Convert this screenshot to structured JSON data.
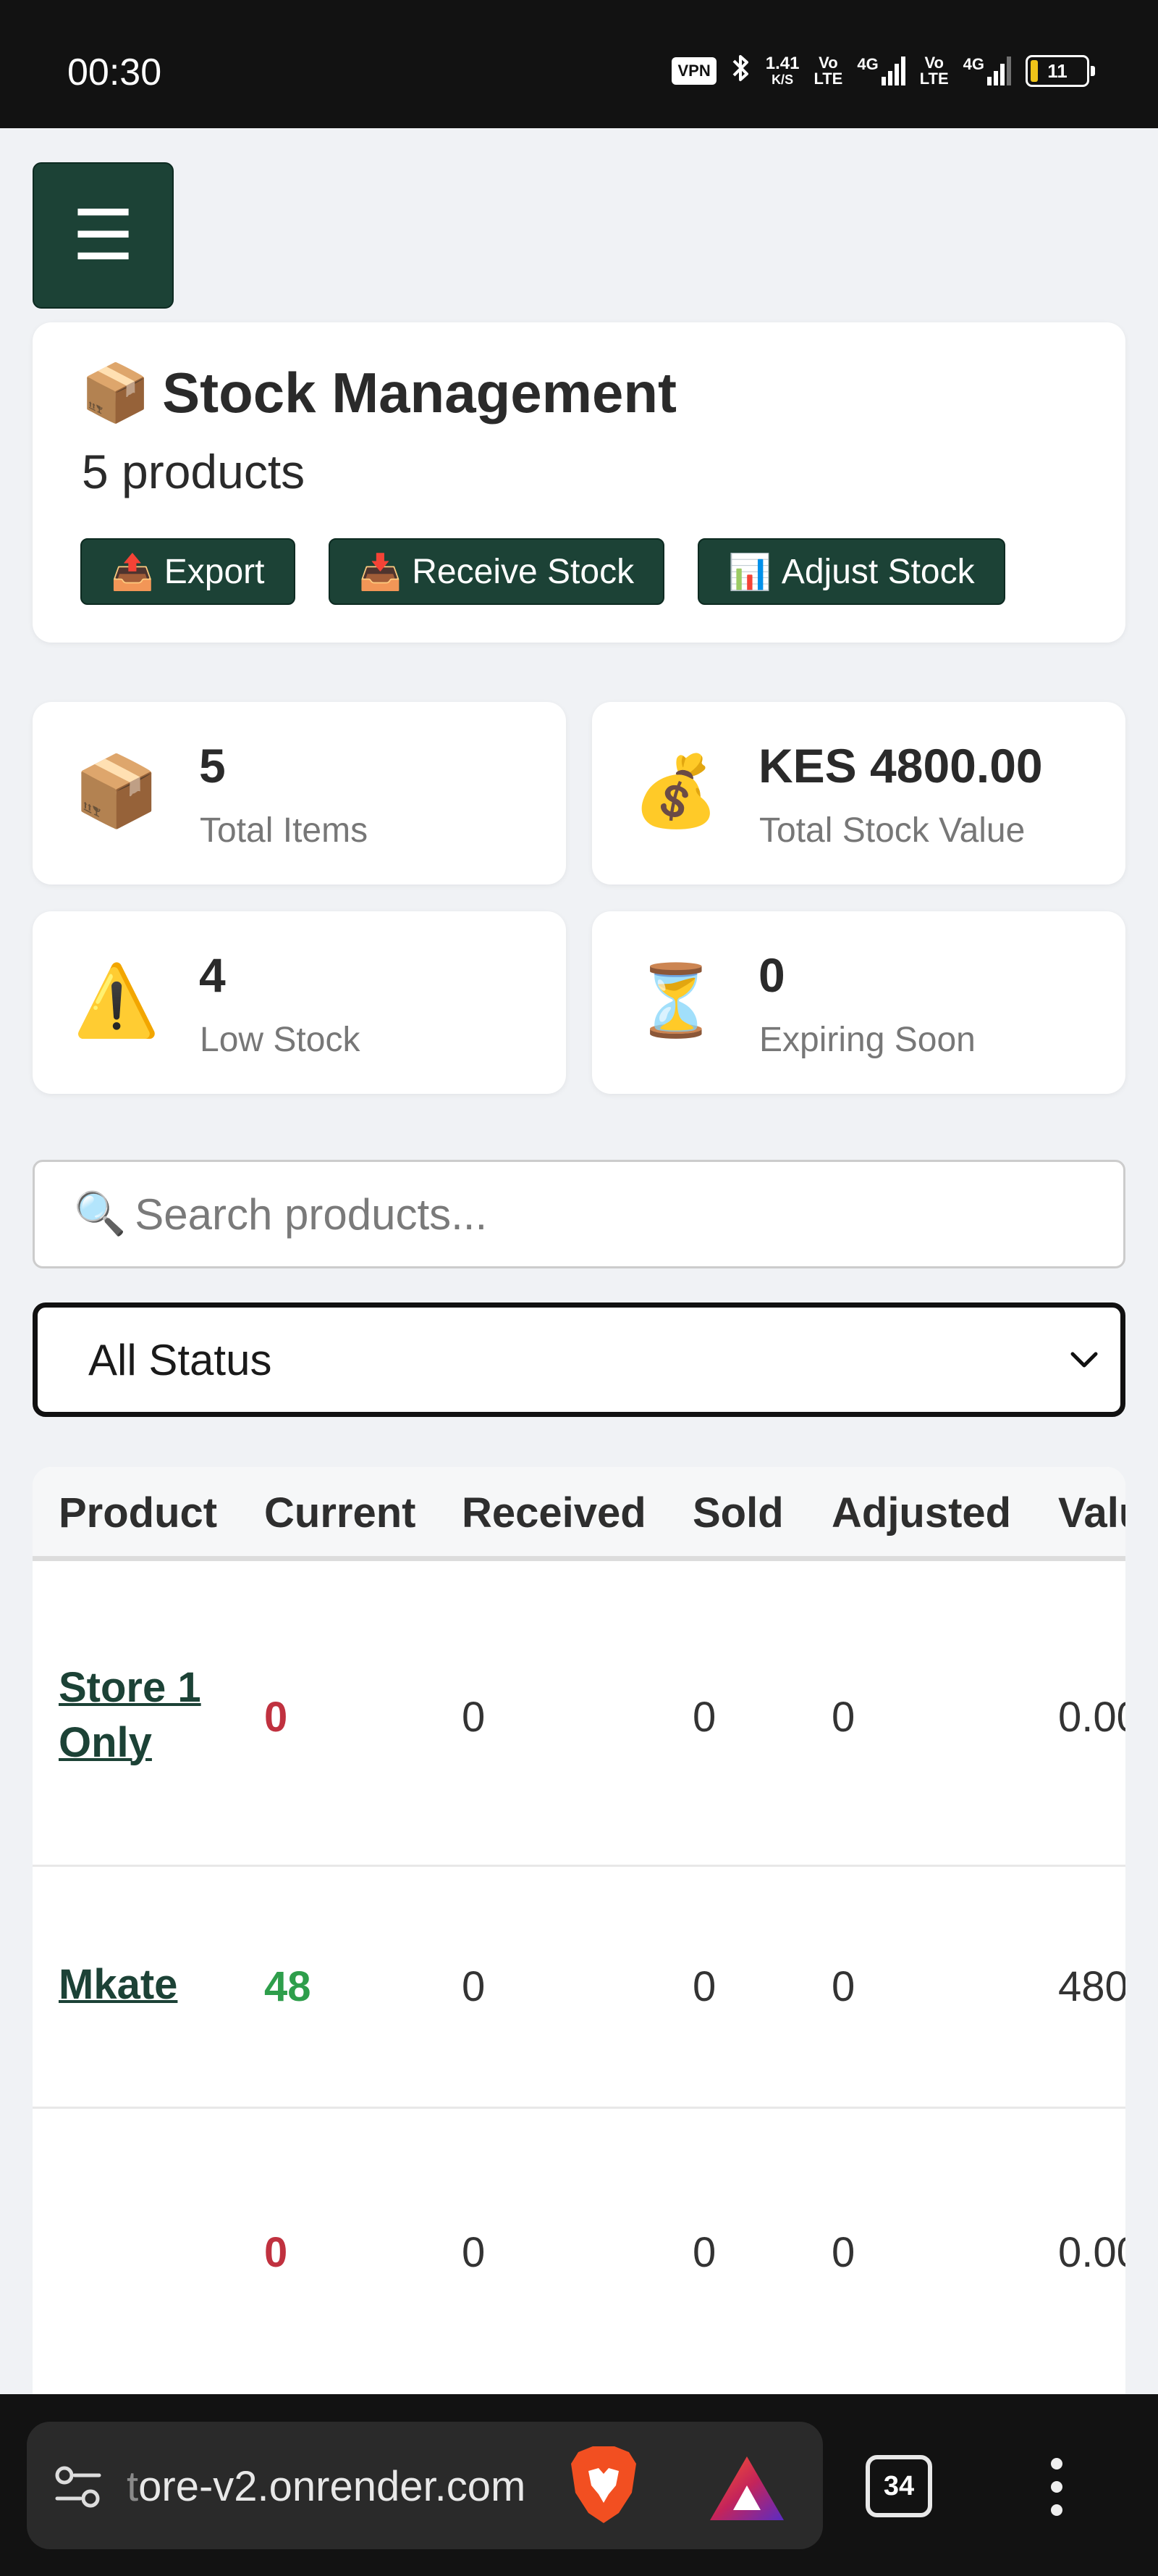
{
  "status_bar": {
    "time": "00:30",
    "vpn": "VPN",
    "speed_value": "1.41",
    "speed_unit": "K/S",
    "net1_top": "Vo",
    "net1_bottom": "LTE",
    "net1_gen": "4G",
    "net2_top": "Vo",
    "net2_bottom": "LTE",
    "net2_gen": "4G",
    "battery": "11"
  },
  "menu": {
    "icon": "hamburger-menu-icon",
    "label": "☰"
  },
  "header": {
    "emoji": "📦",
    "title": "Stock Management",
    "product_count": "5 products",
    "actions": [
      {
        "emoji": "📤",
        "label": "Export"
      },
      {
        "emoji": "📥",
        "label": "Receive Stock"
      },
      {
        "emoji": "📊",
        "label": "Adjust Stock"
      }
    ]
  },
  "stats": [
    {
      "emoji": "📦",
      "value": "5",
      "label": "Total Items"
    },
    {
      "emoji": "💰",
      "value": "KES 4800.00",
      "label": "Total Stock Value"
    },
    {
      "emoji": "⚠️",
      "value": "4",
      "label": "Low Stock"
    },
    {
      "emoji": "⏳",
      "value": "0",
      "label": "Expiring Soon"
    }
  ],
  "search": {
    "emoji": "🔍",
    "placeholder": "Search products..."
  },
  "filter": {
    "selected": "All Status"
  },
  "table": {
    "columns": [
      "Product",
      "Current",
      "Received",
      "Sold",
      "Adjusted",
      "Valu"
    ],
    "rows": [
      {
        "product": "Store 1 Only",
        "current": "0",
        "received": "0",
        "sold": "0",
        "adjusted": "0",
        "value": "0.00"
      },
      {
        "product": "Mkate",
        "current": "48",
        "received": "0",
        "sold": "0",
        "adjusted": "0",
        "value": "480"
      },
      {
        "product": "",
        "current": "0",
        "received": "0",
        "sold": "0",
        "adjusted": "0",
        "value": "0.00"
      }
    ]
  },
  "browser": {
    "url_faded": "t",
    "url": "ore-v2.onrender.com",
    "tab_count": "34"
  },
  "colors": {
    "accent": "#1c4236",
    "low": "#c0313f",
    "ok": "#2e9e4b"
  }
}
